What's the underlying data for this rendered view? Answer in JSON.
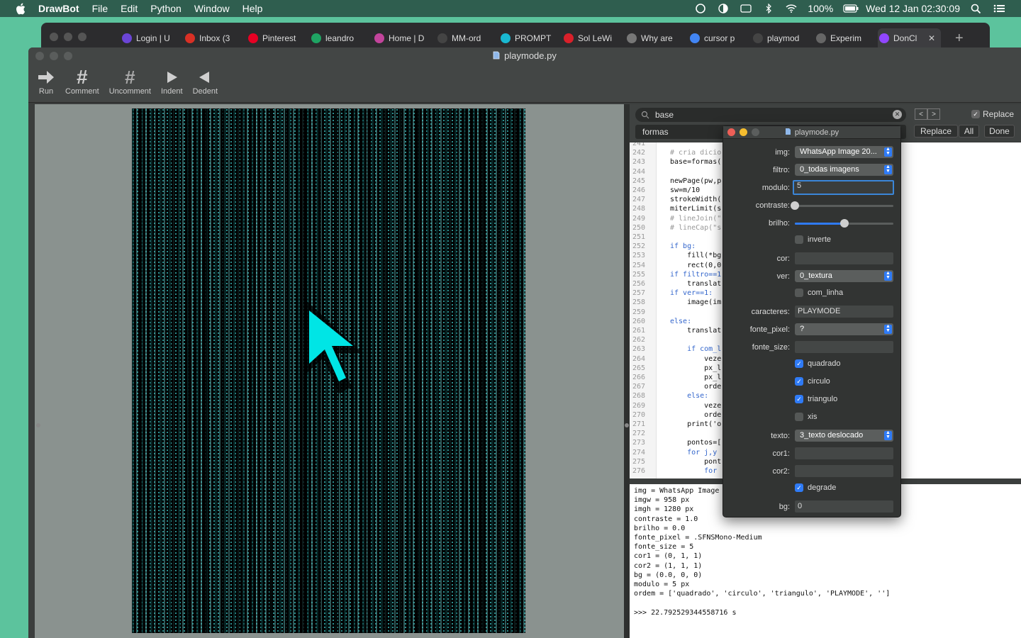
{
  "menubar": {
    "app": "DrawBot",
    "items": [
      "File",
      "Edit",
      "Python",
      "Window",
      "Help"
    ],
    "battery": "100%",
    "clock": "Wed 12 Jan  02:30:09"
  },
  "browser": {
    "tabs": [
      {
        "label": "Login | U",
        "color": "#6b45d6"
      },
      {
        "label": "Inbox (3",
        "color": "#d93025"
      },
      {
        "label": "Pinterest",
        "color": "#e60023"
      },
      {
        "label": "leandro",
        "color": "#1fa463"
      },
      {
        "label": "Home | D",
        "color": "#c2449b"
      },
      {
        "label": "MM-ord",
        "color": "#444"
      },
      {
        "label": "PROMPT",
        "color": "#19b8d1"
      },
      {
        "label": "Sol LeWi",
        "color": "#d9202a"
      },
      {
        "label": "Why are",
        "color": "#777"
      },
      {
        "label": "cursor p",
        "color": "#4285f4"
      },
      {
        "label": "playmod",
        "color": "#444"
      },
      {
        "label": "Experim",
        "color": "#666"
      },
      {
        "label": "DonCl",
        "color": "#9146ff",
        "active": true
      }
    ]
  },
  "window": {
    "title": "playmode.py",
    "toolbar": {
      "run": "Run",
      "comment": "Comment",
      "uncomment": "Uncomment",
      "indent": "Indent",
      "dedent": "Dedent"
    }
  },
  "find": {
    "search": "base",
    "replace_field": "formas",
    "replace_check": "Replace",
    "replace_btn": "Replace",
    "all_btn": "All",
    "done_btn": "Done"
  },
  "code_lines": [
    {
      "n": "241",
      "t": "",
      "cls": ""
    },
    {
      "n": "242",
      "t": "# cria dicio",
      "cls": "cm"
    },
    {
      "n": "243",
      "t": "base=formas(",
      "cls": ""
    },
    {
      "n": "244",
      "t": "",
      "cls": ""
    },
    {
      "n": "245",
      "t": "newPage(pw,p",
      "cls": ""
    },
    {
      "n": "246",
      "t": "sw=m/10",
      "cls": ""
    },
    {
      "n": "247",
      "t": "strokeWidth(",
      "cls": ""
    },
    {
      "n": "248",
      "t": "miterLimit(s",
      "cls": ""
    },
    {
      "n": "249",
      "t": "# lineJoin(\"",
      "cls": "cm"
    },
    {
      "n": "250",
      "t": "# lineCap(\"s",
      "cls": "cm"
    },
    {
      "n": "251",
      "t": "",
      "cls": ""
    },
    {
      "n": "252",
      "t": "if bg:",
      "cls": "kw"
    },
    {
      "n": "253",
      "t": "    fill(*bg",
      "cls": ""
    },
    {
      "n": "254",
      "t": "    rect(0,0",
      "cls": ""
    },
    {
      "n": "255",
      "t": "if filtro==1",
      "cls": "kw"
    },
    {
      "n": "256",
      "t": "    translat",
      "cls": ""
    },
    {
      "n": "257",
      "t": "if ver==1:",
      "cls": "kw"
    },
    {
      "n": "258",
      "t": "    image(im",
      "cls": ""
    },
    {
      "n": "259",
      "t": "",
      "cls": ""
    },
    {
      "n": "260",
      "t": "else:",
      "cls": "kw"
    },
    {
      "n": "261",
      "t": "    translat",
      "cls": ""
    },
    {
      "n": "262",
      "t": "",
      "cls": ""
    },
    {
      "n": "263",
      "t": "    if com_l",
      "cls": "kw"
    },
    {
      "n": "264",
      "t": "        veze",
      "cls": ""
    },
    {
      "n": "265",
      "t": "        px_l",
      "cls": ""
    },
    {
      "n": "266",
      "t": "        px_l",
      "cls": ""
    },
    {
      "n": "267",
      "t": "        orde",
      "cls": ""
    },
    {
      "n": "268",
      "t": "    else:",
      "cls": "kw"
    },
    {
      "n": "269",
      "t": "        veze",
      "cls": ""
    },
    {
      "n": "270",
      "t": "        orde",
      "cls": ""
    },
    {
      "n": "271",
      "t": "    print('o",
      "cls": ""
    },
    {
      "n": "272",
      "t": "",
      "cls": ""
    },
    {
      "n": "273",
      "t": "    pontos=[",
      "cls": ""
    },
    {
      "n": "274",
      "t": "    for j,y",
      "cls": "kw"
    },
    {
      "n": "275",
      "t": "        pont",
      "cls": ""
    },
    {
      "n": "276",
      "t": "        for",
      "cls": "kw"
    }
  ],
  "output_lines": [
    "img = WhatsApp Image",
    "imgw = 958 px",
    "imgh = 1280 px",
    "contraste = 1.0",
    "brilho = 0.0",
    "fonte_pixel = .SFNSMono-Medium",
    "fonte_size = 5",
    "cor1 = (0, 1, 1)",
    "cor2 = (1, 1, 1)",
    "bg = (0.0, 0, 0)",
    "modulo = 5 px",
    "ordem = ['quadrado', 'circulo', 'triangulo', 'PLAYMODE', '']",
    "",
    ">>> 22.792529344558716 s"
  ],
  "panel": {
    "title": "playmode.py",
    "img_label": "img:",
    "img_value": "WhatsApp Image 20...",
    "filtro_label": "filtro:",
    "filtro_value": "0_todas imagens",
    "modulo_label": "modulo:",
    "modulo_value": "5",
    "contraste_label": "contraste:",
    "contraste_value": 0.0,
    "brilho_label": "brilho:",
    "brilho_value": 0.5,
    "inverte_label": "inverte",
    "inverte_checked": false,
    "cor_label": "cor:",
    "ver_label": "ver:",
    "ver_value": "0_textura",
    "com_linha_label": "com_linha",
    "com_linha_checked": false,
    "caracteres_label": "caracteres:",
    "caracteres_value": "PLAYMODE",
    "fonte_pixel_label": "fonte_pixel:",
    "fonte_pixel_value": "?",
    "fonte_size_label": "fonte_size:",
    "quadrado_label": "quadrado",
    "quadrado_checked": true,
    "circulo_label": "circulo",
    "circulo_checked": true,
    "triangulo_label": "triangulo",
    "triangulo_checked": true,
    "xis_label": "xis",
    "xis_checked": false,
    "texto_label": "texto:",
    "texto_value": "3_texto deslocado",
    "cor1_label": "cor1:",
    "cor2_label": "cor2:",
    "degrade_label": "degrade",
    "degrade_checked": true,
    "bg_label": "bg:",
    "bg_value": "0"
  },
  "colors": {
    "accent": "#2f7bf6",
    "cyan": "#00ffff",
    "desktop": "#5cc39d"
  }
}
